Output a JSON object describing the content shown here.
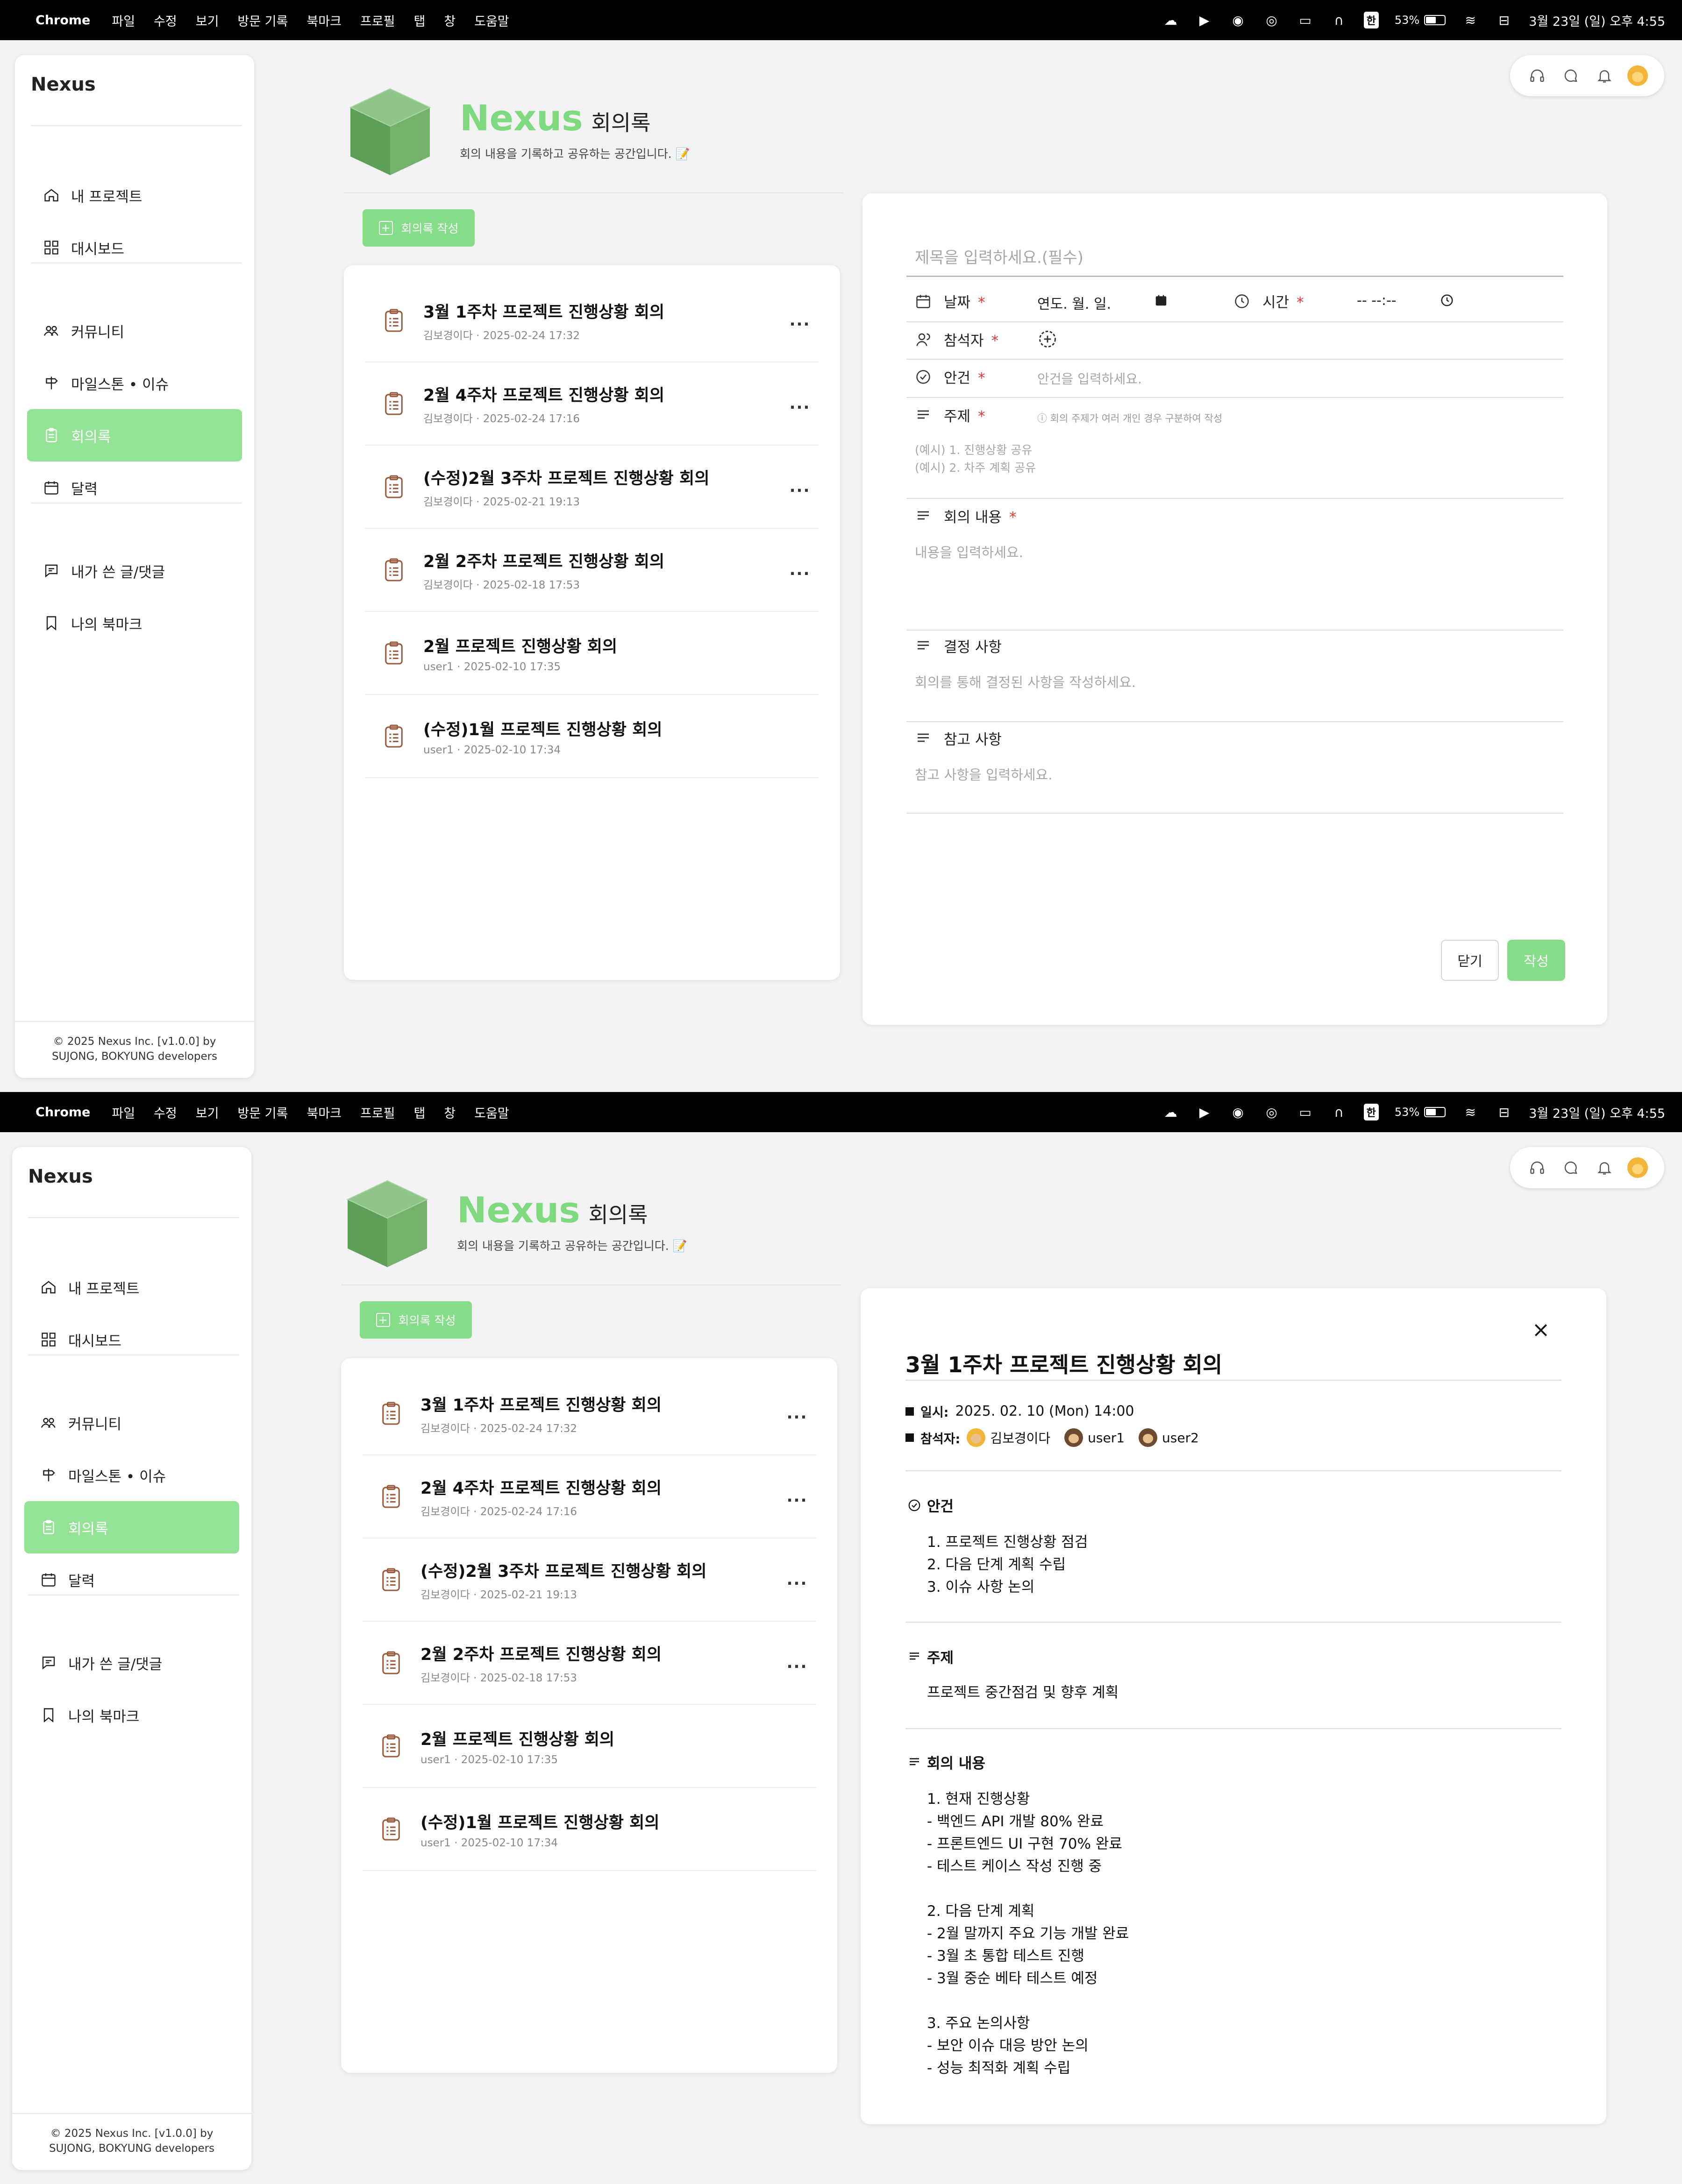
{
  "menubar": {
    "app": "Chrome",
    "items": [
      "파일",
      "수정",
      "보기",
      "방문 기록",
      "북마크",
      "프로필",
      "탭",
      "창",
      "도움말"
    ],
    "ime": "한",
    "battery": "53%",
    "clock": "3월 23일 (일) 오후 4:55"
  },
  "sidebar": {
    "brand": "Nexus",
    "items": [
      {
        "label": "내 프로젝트",
        "icon": "home-icon"
      },
      {
        "label": "대시보드",
        "icon": "grid-icon"
      },
      {
        "label": "커뮤니티",
        "icon": "people-icon"
      },
      {
        "label": "마일스톤 • 이슈",
        "icon": "signpost-icon"
      },
      {
        "label": "회의록",
        "icon": "clipboard-icon"
      },
      {
        "label": "달력",
        "icon": "calendar-icon"
      },
      {
        "label": "내가 쓴 글/댓글",
        "icon": "comment-icon"
      },
      {
        "label": "나의 북마크",
        "icon": "bookmark-icon"
      }
    ],
    "active": "회의록",
    "copyright_line1": "© 2025 Nexus Inc. [v1.0.0] by",
    "copyright_line2": "SUJONG, BOKYUNG developers"
  },
  "header": {
    "brand": "Nexus",
    "title": "회의록",
    "subtitle": "회의 내용을 기록하고 공유하는 공간입니다. 📝"
  },
  "write_button": "회의록 작성",
  "meetings": [
    {
      "title": "3월 1주차 프로젝트 진행상황 회의",
      "meta": "김보경이다 · 2025-02-24 17:32",
      "menu": "..."
    },
    {
      "title": "2월 4주차 프로젝트 진행상황 회의",
      "meta": "김보경이다 · 2025-02-24 17:16",
      "menu": "..."
    },
    {
      "title": "(수정)2월 3주차 프로젝트 진행상황 회의",
      "meta": "김보경이다 · 2025-02-21 19:13",
      "menu": "..."
    },
    {
      "title": "2월 2주차 프로젝트 진행상황 회의",
      "meta": "김보경이다 · 2025-02-18 17:53",
      "menu": "..."
    },
    {
      "title": "2월 프로젝트 진행상황 회의",
      "meta": "user1 · 2025-02-10 17:35",
      "menu": ""
    },
    {
      "title": "(수정)1월 프로젝트 진행상황 회의",
      "meta": "user1 · 2025-02-10 17:34",
      "menu": ""
    }
  ],
  "form": {
    "title_placeholder": "제목을 입력하세요.(필수)",
    "date_label": "날짜",
    "date_value": "연도. 월. 일.",
    "time_label": "시간",
    "time_value": "-- --:--",
    "attendees_label": "참석자",
    "agenda_label": "안건",
    "agenda_placeholder": "안건을 입력하세요.",
    "topic_label": "주제",
    "topic_hint": "ⓘ 회의 주제가 여러 개인 경우 구분하여 작성",
    "topic_placeholder_1": "(예시) 1. 진행상황 공유",
    "topic_placeholder_2": "(예시) 2. 차주 계획 공유",
    "content_label": "회의 내용",
    "content_placeholder": "내용을 입력하세요.",
    "decision_label": "결정 사항",
    "decision_placeholder": "회의를 통해 결정된 사항을 작성하세요.",
    "notes_label": "참고 사항",
    "notes_placeholder": "참고 사항을 입력하세요.",
    "required_mark": "*",
    "close_button": "닫기",
    "submit_button": "작성"
  },
  "detail": {
    "title": "3월 1주차 프로젝트 진행상황 회의",
    "datetime_label": "일시:",
    "datetime_value": "2025. 02. 10 (Mon) 14:00",
    "attendees_label": "참석자:",
    "attendees": [
      "김보경이다",
      "user1",
      "user2"
    ],
    "agenda_label": "안건",
    "agenda_body": "1. 프로젝트 진행상황 점검\n2. 다음 단계 계획 수립\n3. 이슈 사항 논의",
    "topic_label": "주제",
    "topic_body": "프로젝트 중간점검 및 향후 계획",
    "content_label": "회의 내용",
    "content_body": "1. 현재 진행상황\n- 백엔드 API 개발 80% 완료\n- 프론트엔드 UI 구현 70% 완료\n- 테스트 케이스 작성 진행 중\n\n2. 다음 단계 계획\n- 2월 말까지 주요 기능 개발 완료\n- 3월 초 통합 테스트 진행\n- 3월 중순 베타 테스트 예정\n\n3. 주요 논의사항\n- 보안 이슈 대응 방안 논의\n- 성능 최적화 계획 수립"
  },
  "colors": {
    "accent_green": "#86dd87",
    "active_nav": "#93e394",
    "brand_green": "#7ed97f",
    "required_red": "#e03a3a",
    "clipboard_brown": "#9a5a3c"
  }
}
